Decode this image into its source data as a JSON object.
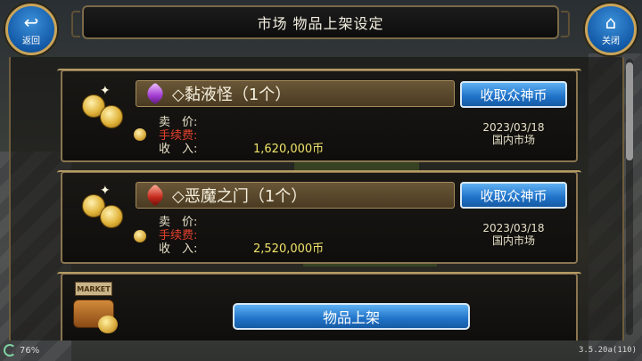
{
  "header": {
    "title": "市场  物品上架设定"
  },
  "nav": {
    "back": {
      "label": "返回",
      "icon": "return-arrow-icon"
    },
    "close": {
      "label": "关闭",
      "icon": "house-icon"
    }
  },
  "listings": [
    {
      "item_name": "◇黏液怪（1个）",
      "gem_color": "#a23bd1",
      "collect_label": "收取众神币",
      "price_label": "卖　价:",
      "fee_label": "手续费:",
      "income_label": "收　入:",
      "income_value": "1,620,000币",
      "date": "2023/03/18",
      "market": "国内市场"
    },
    {
      "item_name": "◇恶魔之门（1个）",
      "gem_color": "#c3281c",
      "collect_label": "收取众神币",
      "price_label": "卖　价:",
      "fee_label": "手续费:",
      "income_label": "收　入:",
      "income_value": "2,520,000币",
      "date": "2023/03/18",
      "market": "国内市场"
    }
  ],
  "footer": {
    "market_sign": "MARKET",
    "list_item_label": "物品上架",
    "battery": "76%",
    "version": "3.5.20a(110)"
  },
  "colors": {
    "accent": "#1f72c8",
    "frame": "#8a7550",
    "fee_red": "#e0402e",
    "value_yellow": "#f0e26a"
  }
}
